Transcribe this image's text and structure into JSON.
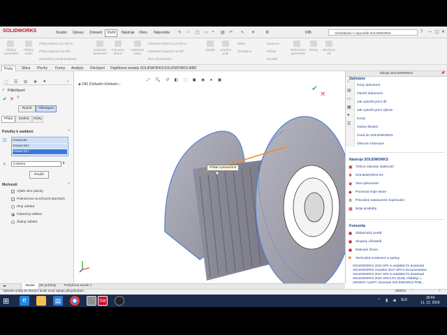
{
  "app": {
    "logo": "SOLIDWORKS",
    "doc_title": "Díl5",
    "search_placeholder": "Vyhledávání v nápovědě SOLIDWORKS"
  },
  "menu": [
    "Soubor",
    "Úpravy",
    "Zobrazit",
    "Vložit",
    "Nástroje",
    "Okno",
    "Nápověda"
  ],
  "menu_selected": "Vložit",
  "ribbon": {
    "items": [
      "Přidání vysunutím",
      "Přidání rotací",
      "Přidat tažením po křivce",
      "Přidat spojením profilů",
      "Ohraničení přidání/základu",
      "Odebrání vysunutím",
      "Průvodce dírami",
      "Odebrání rotací",
      "Odebrání tažením po křivce",
      "Odebrání spojením profilů",
      "Řez ohraničením",
      "Zaoblit",
      "Lineární pole",
      "Žebro",
      "Skořepina",
      "Navinout",
      "Průnik",
      "Zrcadlit",
      "Referenční geometrie",
      "Křivky",
      "Bleskový 3D"
    ]
  },
  "tabs": [
    "Prvky",
    "Skica",
    "Plochy",
    "Formy",
    "Analýzy",
    "DimXpert",
    "Doplňkové moduly SOLIDWORKS",
    "SOLIDWORKS MBD"
  ],
  "tabs_active": "Prvky",
  "left_panel": {
    "title": "FilletXpert",
    "mode_buttons": [
      "Ručně",
      "FilletXpert"
    ],
    "subtabs": [
      "Přidat",
      "Změnit",
      "Rohy"
    ],
    "items_header": "Položky k zaoblení",
    "items": [
      "Hrana<9>",
      "Hrana<10>",
      "Hrana<11>"
    ],
    "radius": "0.20mm",
    "apply_button": "Použít",
    "options_header": "Možnosti",
    "checkboxes": [
      {
        "label": "Výběr skrz plochy",
        "checked": true
      },
      {
        "label": "Pokračovat na tečných plochách",
        "checked": true
      }
    ],
    "radios": [
      {
        "label": "Plný náhled",
        "checked": false
      },
      {
        "label": "Částečný náhled",
        "checked": true
      },
      {
        "label": "Žádný náhled",
        "checked": false
      }
    ]
  },
  "viewport": {
    "tree_label": "Díl5  (Default<<Default>...",
    "tooltip": "Přidat vysunutím2"
  },
  "right_panel": {
    "title": "Zdroje SOLIDWORKS",
    "sections": [
      {
        "header": "Začínáme",
        "links": [
          "Nový dokument",
          "Otevřít dokument",
          "Jak vytvořit první díl",
          "Jak vytvořit první výkres",
          "Kurzy",
          "Online školení",
          "Úvod do SOLIDWORKS",
          "Obecné informace"
        ]
      },
      {
        "header": "Nástroje SOLIDWORKS",
        "links": [
          "Tvůrce zásuvky vlastností",
          "SOLIDWORKS Rx",
          "Test výkonnosti",
          "Porovnat moje skóre",
          "Průvodce nastavením kopírování",
          "Moje produkty"
        ]
      },
      {
        "header": "Komunita",
        "links": [
          "Zákaznický portál",
          "Skupiny uživatelů",
          "Diskusní fórum",
          "Technická oznámení a zprávy"
        ]
      }
    ],
    "news": [
      "SOLIDWORKS 2016 SP5 is available for download",
      "SOLIDWORKS Visualize 2017 SP0.0 Documentation",
      "SOLIDWORKS 2017 SP0 is available for download",
      "SOLIDWORKS 2016 SP5.0 EV (Early Visibility) i...",
      "URGENT ALERT: Important SOLIDWORKS PDM..."
    ]
  },
  "bottom_tabs": [
    "Model",
    "3D pohledy",
    "Pohybová studie 1"
  ],
  "bottom_tabs_active": "Model",
  "status": {
    "message": "Vyberte entity ke kterým bude nový splajn přizpůsoben.",
    "units": "MMGS"
  },
  "taskbar": {
    "language": "SLK",
    "time": "18:44",
    "date": "11. 12. 2016"
  },
  "colors": {
    "accent_blue": "#2f6fd8",
    "highlight_orange": "#f08a24",
    "model_gray": "#9a9aa8",
    "link_blue": "#1b3c8c",
    "taskbar": "#1c2b4a"
  }
}
